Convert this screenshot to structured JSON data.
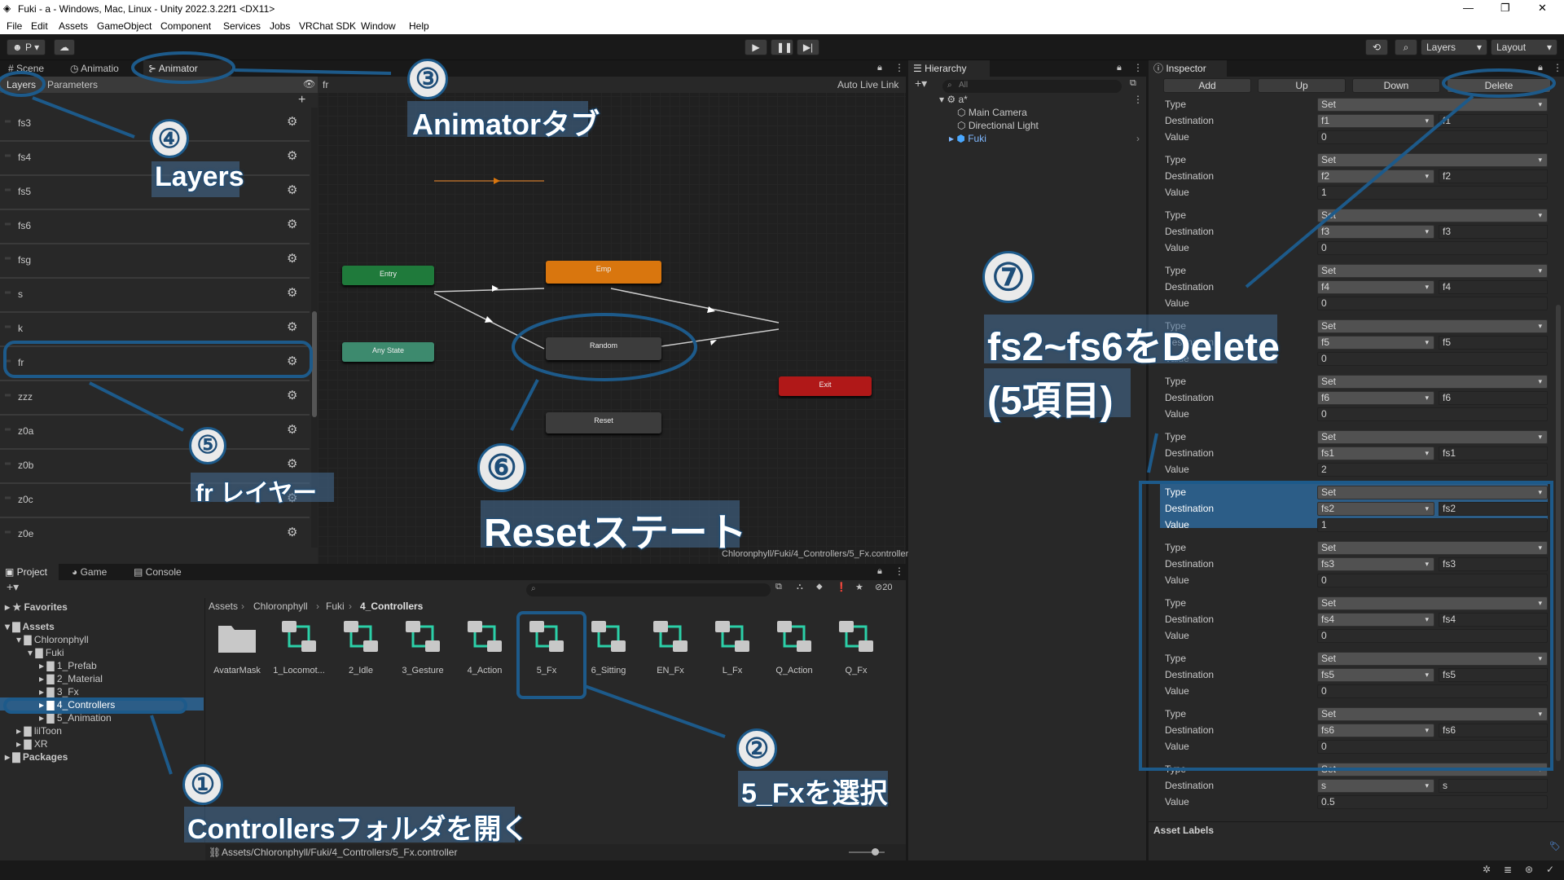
{
  "window": {
    "title": "Fuki - a - Windows, Mac, Linux - Unity 2022.3.22f1 <DX11>"
  },
  "menu": [
    "File",
    "Edit",
    "Assets",
    "GameObject",
    "Component",
    "Services",
    "Jobs",
    "VRChat SDK",
    "Window",
    "Help"
  ],
  "toolbar": {
    "account": "P",
    "layers": "Layers",
    "layout": "Layout"
  },
  "scene_tabs": {
    "scene": "Scene",
    "animation": "Animatio",
    "animator": "Animator"
  },
  "animator": {
    "layers_tab": "Layers",
    "parameters_tab": "Parameters",
    "breadcrumb": "fr",
    "auto_live_link": "Auto Live Link",
    "footer_path": "Chloronphyll/Fuki/4_Controllers/5_Fx.controller",
    "layers": [
      "fs3",
      "fs4",
      "fs5",
      "fs6",
      "fsg",
      "s",
      "k",
      "fr",
      "zzz",
      "z0a",
      "z0b",
      "z0c",
      "z0e"
    ],
    "nodes": {
      "entry": "Entry",
      "emp": "Emp",
      "any_state": "Any State",
      "random": "Random",
      "exit": "Exit",
      "reset": "Reset"
    }
  },
  "hierarchy": {
    "title": "Hierarchy",
    "search_placeholder": "All",
    "scene": "a*",
    "items": [
      "Main Camera",
      "Directional Light",
      "Fuki"
    ]
  },
  "inspector": {
    "title": "Inspector",
    "buttons": {
      "add": "Add",
      "up": "Up",
      "down": "Down",
      "delete": "Delete"
    },
    "labels": {
      "type": "Type",
      "destination": "Destination",
      "value": "Value"
    },
    "entries": [
      {
        "type": "Set",
        "dest": "f1",
        "dest_text": "f1",
        "value": "0"
      },
      {
        "type": "Set",
        "dest": "f2",
        "dest_text": "f2",
        "value": "1"
      },
      {
        "type": "Set",
        "dest": "f3",
        "dest_text": "f3",
        "value": "0"
      },
      {
        "type": "Set",
        "dest": "f4",
        "dest_text": "f4",
        "value": "0"
      },
      {
        "type": "Set",
        "dest": "f5",
        "dest_text": "f5",
        "value": "0"
      },
      {
        "type": "Set",
        "dest": "f6",
        "dest_text": "f6",
        "value": "0"
      },
      {
        "type": "Set",
        "dest": "fs1",
        "dest_text": "fs1",
        "value": "2"
      },
      {
        "type": "Set",
        "dest": "fs2",
        "dest_text": "fs2",
        "value": "1"
      },
      {
        "type": "Set",
        "dest": "fs3",
        "dest_text": "fs3",
        "value": "0"
      },
      {
        "type": "Set",
        "dest": "fs4",
        "dest_text": "fs4",
        "value": "0"
      },
      {
        "type": "Set",
        "dest": "fs5",
        "dest_text": "fs5",
        "value": "0"
      },
      {
        "type": "Set",
        "dest": "fs6",
        "dest_text": "fs6",
        "value": "0"
      },
      {
        "type": "Set",
        "dest": "s",
        "dest_text": "s",
        "value": "0.5"
      }
    ],
    "asset_labels": "Asset Labels"
  },
  "project": {
    "tabs": {
      "project": "Project",
      "game": "Game",
      "console": "Console"
    },
    "hidden_count": "20",
    "breadcrumb": [
      "Assets",
      "Chloronphyll",
      "Fuki",
      "4_Controllers"
    ],
    "tree": {
      "favorites": "Favorites",
      "assets": "Assets",
      "chloronphyll": "Chloronphyll",
      "fuki": "Fuki",
      "prefab": "1_Prefab",
      "material": "2_Material",
      "fx": "3_Fx",
      "controllers": "4_Controllers",
      "animation": "5_Animation",
      "liltoon": "lilToon",
      "xr": "XR",
      "packages": "Packages"
    },
    "assets": [
      "AvatarMask",
      "1_Locomot...",
      "2_Idle",
      "3_Gesture",
      "4_Action",
      "5_Fx",
      "6_Sitting",
      "EN_Fx",
      "L_Fx",
      "Q_Action",
      "Q_Fx"
    ],
    "footer_path": "Assets/Chloronphyll/Fuki/4_Controllers/5_Fx.controller"
  },
  "annotations": {
    "n1": "①",
    "t1": "Controllersフォルダを開く",
    "n2": "②",
    "t2": "5_Fxを選択",
    "n3": "③",
    "t3": "Animatorタブ",
    "n4": "④",
    "t4": "Layers",
    "n5": "⑤",
    "t5": "fr レイヤー",
    "n6": "⑥",
    "t6": "Resetステート",
    "n7": "⑦",
    "t7a": "fs2~fs6をDelete",
    "t7b": "(5項目)"
  },
  "colors": {
    "accent": "#2c5d87",
    "annotation": "#1d5a8a",
    "entry": "#1f7a3b",
    "exit": "#b01818",
    "emp": "#d9760e",
    "any_state": "#3d8a6e"
  }
}
